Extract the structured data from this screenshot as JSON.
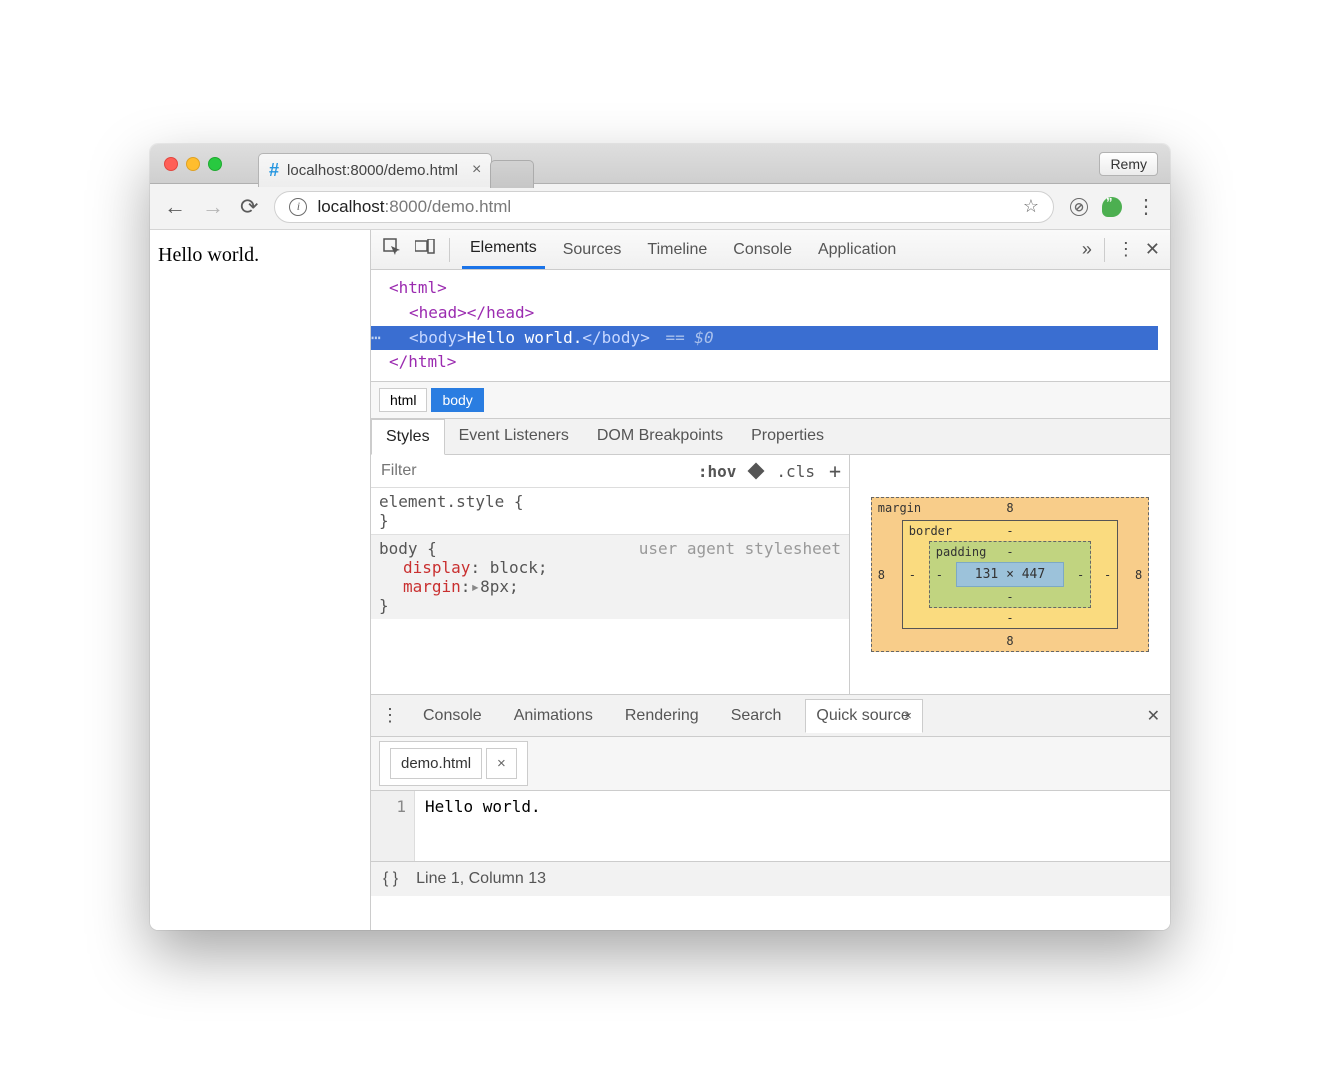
{
  "browser": {
    "tab_title": "localhost:8000/demo.html",
    "profile_button": "Remy",
    "url_host": "localhost",
    "url_port": ":8000",
    "url_path": "/demo.html"
  },
  "page": {
    "content": "Hello world."
  },
  "devtools": {
    "tabs": [
      "Elements",
      "Sources",
      "Timeline",
      "Console",
      "Application"
    ],
    "active_tab": "Elements",
    "dom": {
      "open_html": "<html>",
      "head": "<head></head>",
      "body_open": "<body>",
      "body_text": "Hello world.",
      "body_close": "</body>",
      "eq": "== $0",
      "close_html": "</html>"
    },
    "breadcrumb": [
      "html",
      "body"
    ],
    "style_subtabs": [
      "Styles",
      "Event Listeners",
      "DOM Breakpoints",
      "Properties"
    ],
    "filter_placeholder": "Filter",
    "filter_hov": ":hov",
    "filter_cls": ".cls",
    "css": {
      "element_style_selector": "element.style {",
      "element_style_close": "}",
      "body_selector": "body {",
      "body_origin": "user agent stylesheet",
      "prop_display": "display",
      "val_display": "block",
      "prop_margin": "margin",
      "val_margin": "8px",
      "body_close": "}"
    },
    "box_model": {
      "margin_label": "margin",
      "border_label": "border",
      "padding_label": "padding",
      "margin_value": "8",
      "border_value": "-",
      "padding_value": "-",
      "content": "131 × 447"
    },
    "drawer_tabs": [
      "Console",
      "Animations",
      "Rendering",
      "Search",
      "Quick source"
    ],
    "drawer_active": "Quick source",
    "source_filename": "demo.html",
    "source_line_no": "1",
    "source_line": "Hello world.",
    "status_braces": "{ }",
    "status_cursor": "Line 1, Column 13"
  }
}
